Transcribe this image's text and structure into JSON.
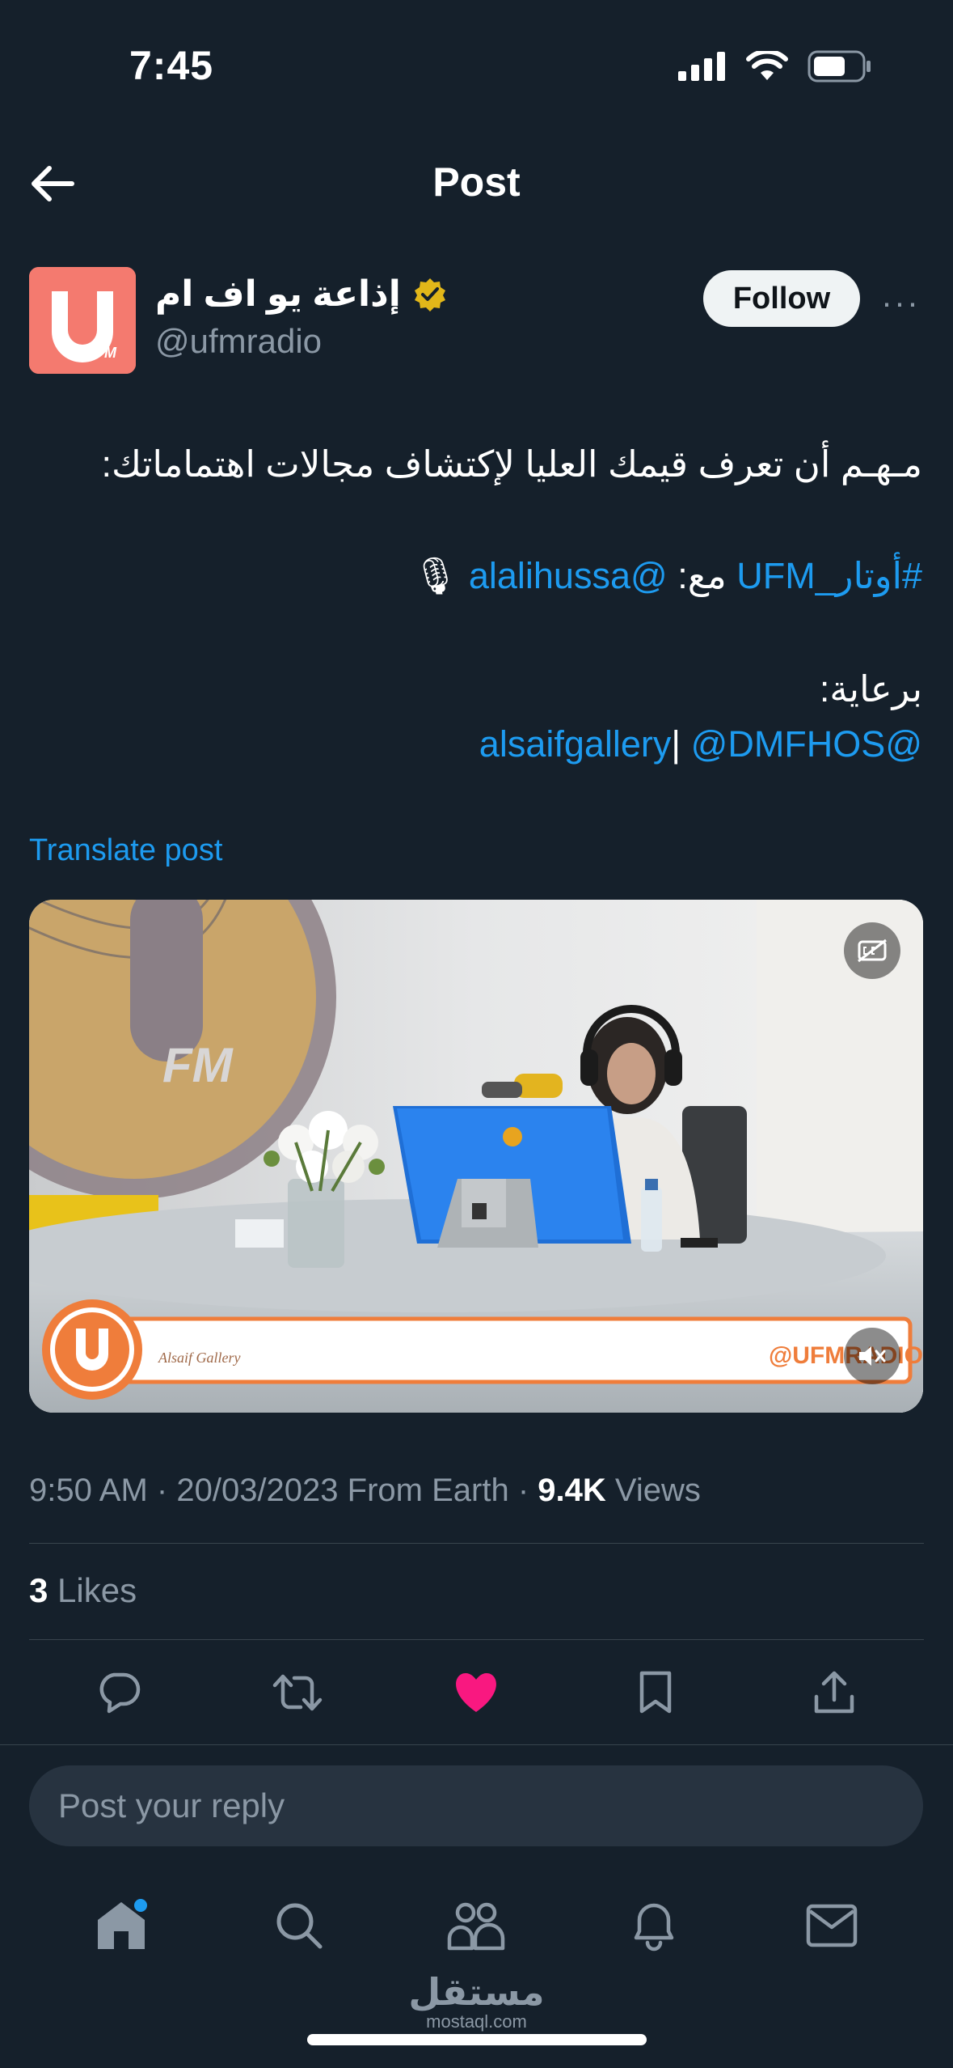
{
  "status_bar": {
    "time": "7:45"
  },
  "header": {
    "title": "Post"
  },
  "author": {
    "name": "إذاعة يو اف ام",
    "handle": "@ufmradio",
    "follow_label": "Follow",
    "more_label": "···",
    "avatar_text": "FM"
  },
  "post": {
    "line1": "مـهـم أن تعرف قيمك العليا لإكتشاف مجالات اهتماماتك:",
    "hashtag": "#أوتار_UFM",
    "with_text": " مع: ",
    "mention1": "@alalihussa",
    "mic_emoji": "🎙",
    "sponsor_label": "برعاية:",
    "mention2": "@alsaifgallery",
    "separator": "|",
    "mention3": "@DMFHOS",
    "translate_label": "Translate post"
  },
  "media": {
    "watermark_handle": "@UFMRADIO",
    "logo_text": "FM",
    "gallery_text": "Alsaif Gallery"
  },
  "meta": {
    "time": "9:50 AM",
    "date": "20/03/2023",
    "location": "From Earth",
    "views_count": "9.4K",
    "views_label": "Views",
    "separator": "·"
  },
  "likes": {
    "count": "3",
    "label": "Likes"
  },
  "reply": {
    "placeholder": "Post your reply"
  },
  "watermark": {
    "brand": "مستقل",
    "domain": "mostaql.com"
  },
  "colors": {
    "background": "#15202b",
    "accent": "#1d9bf0",
    "like": "#f91880",
    "muted": "#8b98a5"
  }
}
